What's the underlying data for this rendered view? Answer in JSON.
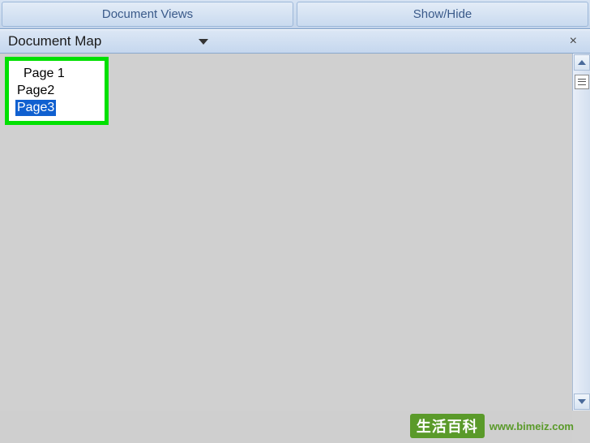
{
  "ribbon": {
    "groups": [
      {
        "label": "Document Views"
      },
      {
        "label": "Show/Hide"
      }
    ]
  },
  "pane": {
    "title": "Document Map",
    "close_label": "×"
  },
  "docmap": {
    "items": [
      {
        "label": "Page 1",
        "selected": false,
        "indent": 1
      },
      {
        "label": "Page2",
        "selected": false,
        "indent": 0
      },
      {
        "label": "Page3",
        "selected": true,
        "indent": 0
      }
    ]
  },
  "watermark": {
    "logo_text": "生活百科",
    "url": "www.bimeiz.com"
  }
}
